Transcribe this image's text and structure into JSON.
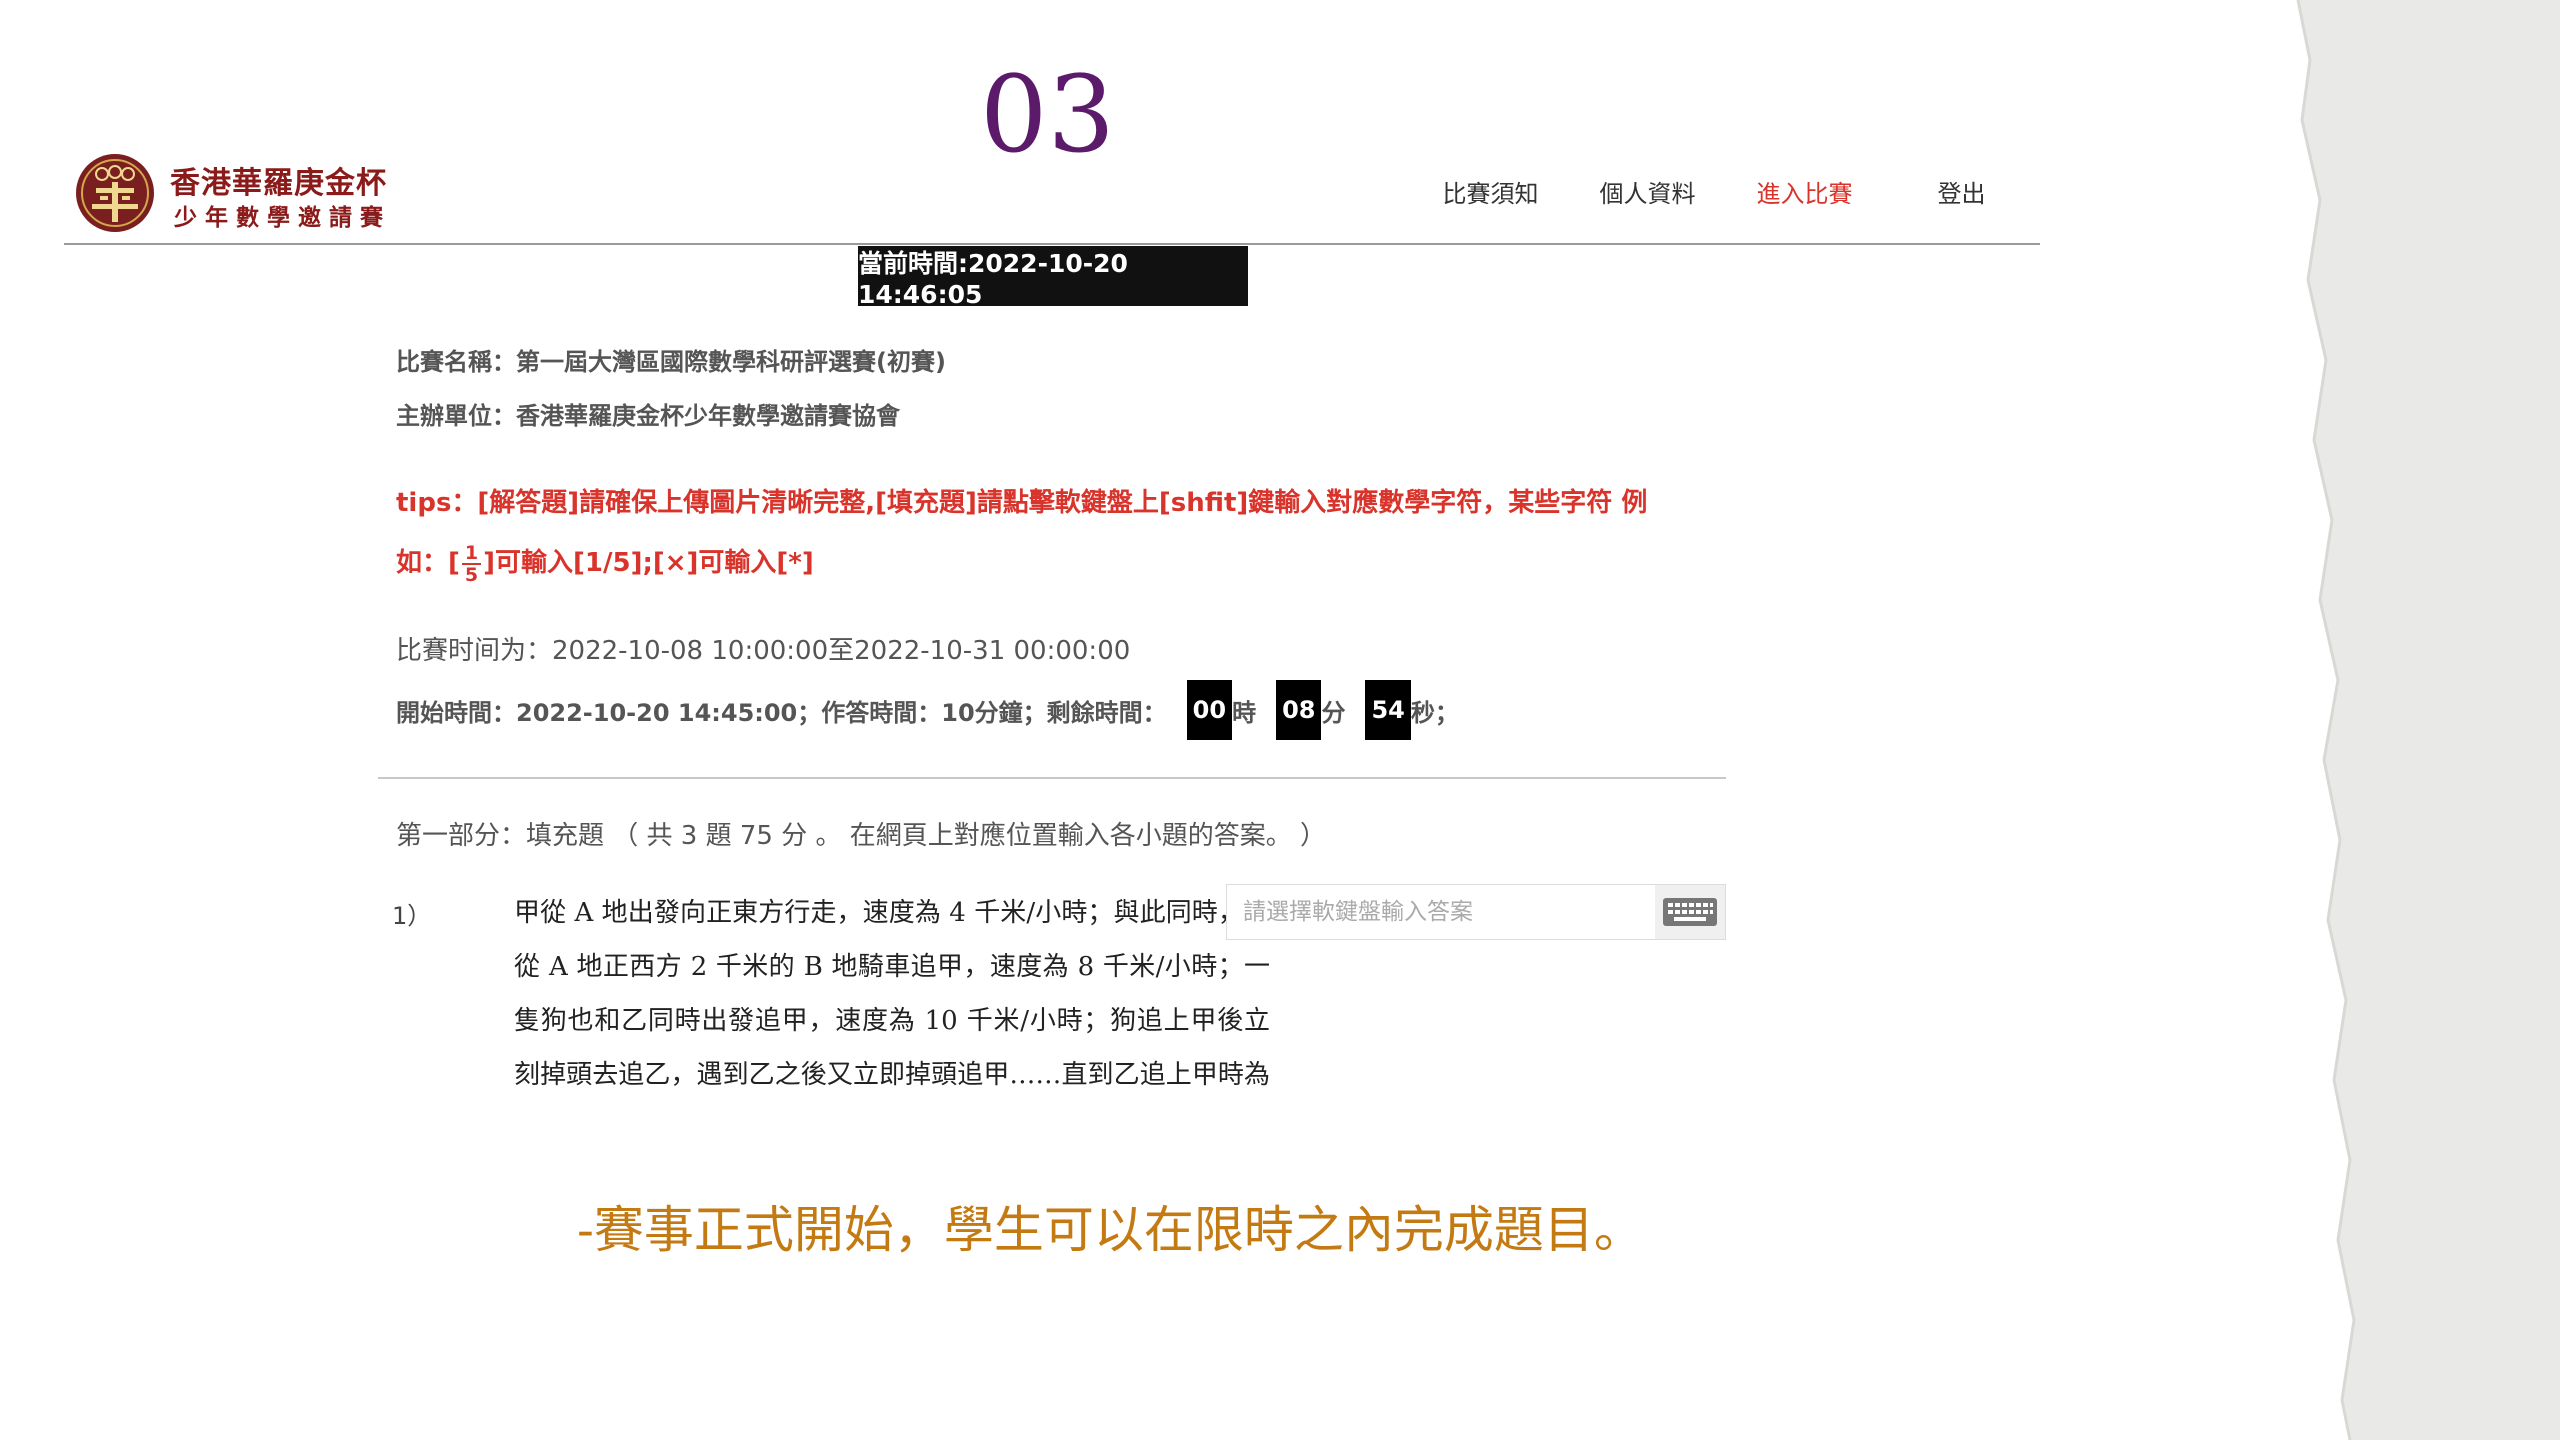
{
  "slide": {
    "number": "03",
    "caption": "-賽事正式開始，學生可以在限時之內完成題目。"
  },
  "logo": {
    "line1": "香港華羅庚金杯",
    "line2": "少年數學邀請賽"
  },
  "nav": {
    "items": [
      {
        "label": "比賽須知"
      },
      {
        "label": "個人資料"
      },
      {
        "label": "進入比賽"
      },
      {
        "label": "登出"
      }
    ],
    "active": "進入比賽"
  },
  "current_time": "當前時間:2022-10-20 14:46:05",
  "info": {
    "contest_name": "比賽名稱：第一屆大灣區國際數學科研評選賽(初賽)",
    "organizer": "主辦單位：香港華羅庚金杯少年數學邀請賽協會"
  },
  "tips": {
    "line1": "tips：[解答題]請確保上傳圖片清晰完整,[填充題]請點擊軟鍵盤上[shfit]鍵輸入對應數學字符，某些字符  例",
    "line2_prefix": "如：[",
    "frac_num": "1",
    "frac_den": "5",
    "line2_suffix": "]可輸入[1/5];[×]可輸入[*]"
  },
  "time_range": "比賽时间为：2022-10-08  10:00:00至2022-10-31  00:00:00",
  "timer": {
    "prefix": "開始時間：2022-10-20 14:45:00；作答時間：10分鐘；剩餘時間：",
    "hours": "00",
    "hours_unit": "時",
    "minutes": "08",
    "minutes_unit": "分",
    "seconds": "54",
    "seconds_unit": "秒；"
  },
  "section": {
    "title": "第一部分：填充題 （ 共 3 題 75 分 。 在網頁上對應位置輸入各小題的答案。 ）"
  },
  "question": {
    "number": "1）",
    "text": "甲從 A 地出發向正東方行走，速度為 4 千米/小時；與此同時，乙從 A 地正西方 2 千米的 B 地騎車追甲，速度為 8 千米/小時；一隻狗也和乙同時出發追甲，速度為 10 千米/小時；狗追上甲後立刻掉頭去追乙，遇到乙之後又立即掉頭追甲……直到乙追上甲時為止。"
  },
  "answer": {
    "placeholder": "請選擇軟鍵盤輸入答案",
    "value": ""
  },
  "icons": {
    "keyboard": "keyboard-icon",
    "seal": "seal-logo-icon"
  },
  "colors": {
    "slide_number": "#5c1a6b",
    "caption": "#c47a12",
    "active_nav": "#d9342b",
    "tips": "#d9342b",
    "logo": "#8b1a1a"
  }
}
